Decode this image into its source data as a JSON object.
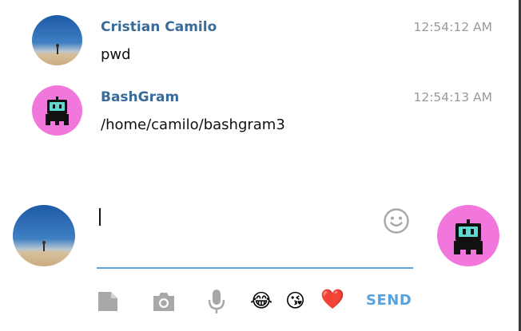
{
  "messages": [
    {
      "sender": "Cristian Camilo",
      "time": "12:54:12 AM",
      "text": "pwd",
      "avatar": "user-photo"
    },
    {
      "sender": "BashGram",
      "time": "12:54:13 AM",
      "text": "/home/camilo/bashgram3",
      "avatar": "bot-robot"
    }
  ],
  "composer": {
    "input_value": "",
    "emoji_picker_icon": "smiley-face-icon",
    "tools": [
      "document-icon",
      "camera-icon",
      "microphone-icon"
    ],
    "quick_emojis": [
      "😂",
      "😘",
      "❤️"
    ],
    "send_label": "SEND"
  },
  "colors": {
    "sender_name": "#3a6a98",
    "accent": "#5aa2dc",
    "bot_avatar_bg": "#f177dd",
    "timestamp": "#9a9a9a"
  }
}
